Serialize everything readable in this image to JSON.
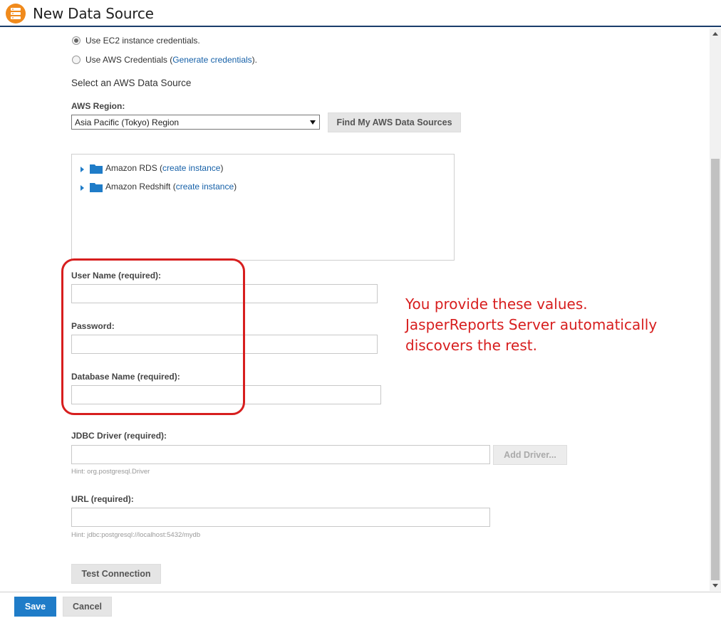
{
  "header": {
    "title": "New Data Source",
    "icon": "database-icon",
    "accent": "#f08a1c"
  },
  "credentials": {
    "ec2_label": "Use EC2 instance credentials.",
    "aws_prefix": "Use AWS Credentials (",
    "aws_link": "Generate credentials",
    "aws_suffix": ")."
  },
  "aws_source": {
    "heading": "Select an AWS Data Source",
    "region_label": "AWS Region:",
    "region_value": "Asia Pacific (Tokyo) Region",
    "find_button": "Find My AWS Data Sources",
    "tree": [
      {
        "label": "Amazon RDS",
        "link": "create instance"
      },
      {
        "label": "Amazon Redshift",
        "link": "create instance"
      }
    ]
  },
  "form": {
    "username_label": "User Name (required):",
    "password_label": "Password:",
    "dbname_label": "Database Name (required):",
    "jdbc_label": "JDBC Driver (required):",
    "jdbc_hint": "Hint: org.postgresql.Driver",
    "add_driver_button": "Add Driver...",
    "url_label": "URL (required):",
    "url_hint": "Hint: jdbc:postgresql://localhost:5432/mydb",
    "test_button": "Test Connection"
  },
  "annotation": {
    "lines": [
      "You provide these values.",
      "JasperReports Server automatically",
      "discovers the rest."
    ],
    "color": "#d71e1e"
  },
  "footer": {
    "save_button": "Save",
    "cancel_button": "Cancel",
    "save_color": "#1f7cc8"
  }
}
